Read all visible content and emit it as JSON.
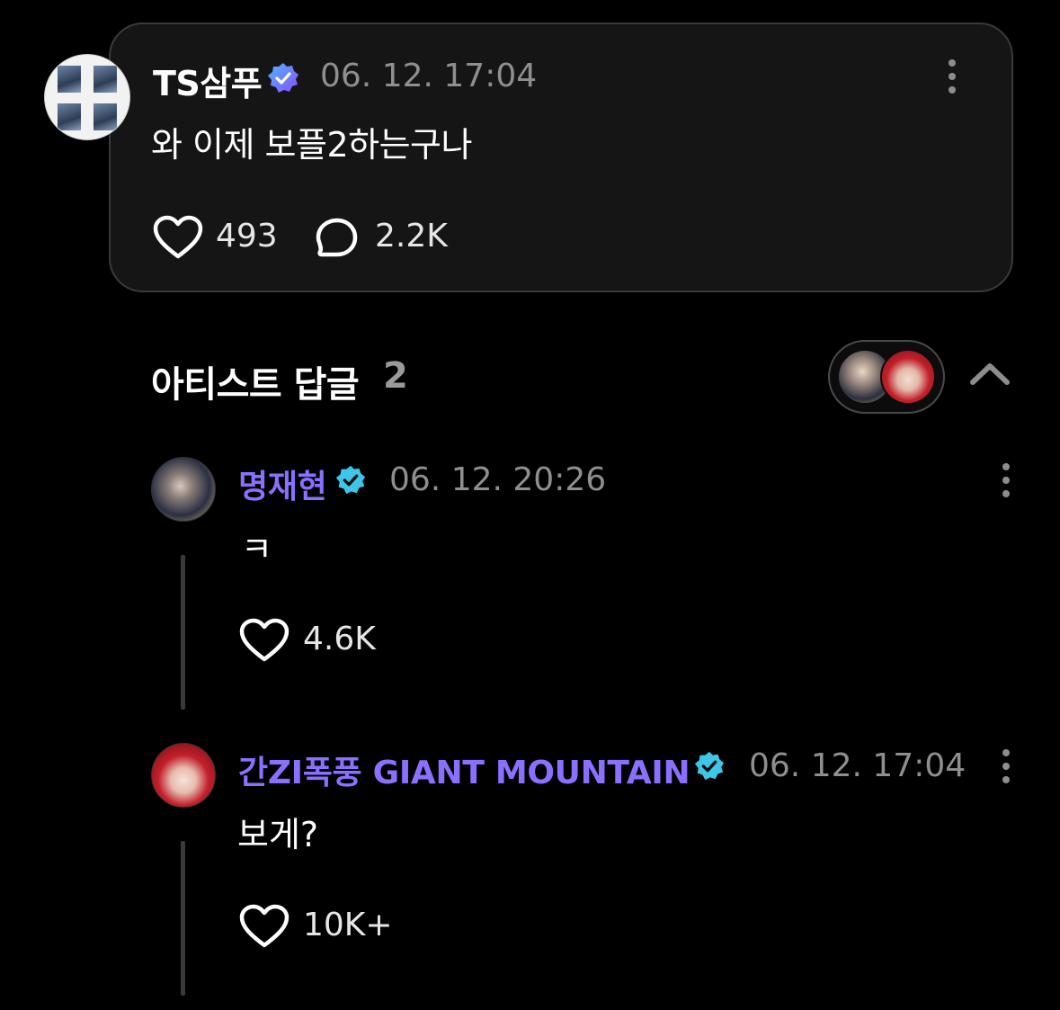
{
  "post": {
    "author": "TS삼푸",
    "time": "06. 12. 17:04",
    "body": "와 이제 보플2하는구나",
    "likes": "493",
    "comments": "2.2K"
  },
  "artist_replies": {
    "title": "아티스트 답글",
    "count": "2"
  },
  "replies": [
    {
      "name": "명재현",
      "time": "06. 12. 20:26",
      "text": "ㅋ",
      "likes": "4.6K"
    },
    {
      "name": "간ZI폭풍 GIANT MOUNTAIN",
      "time": "06. 12. 17:04",
      "text": "보게?",
      "likes": "10K+"
    }
  ],
  "colors": {
    "background": "#000000",
    "card": "#151515",
    "artist_name": "#8b70ff",
    "verified_badge_artist": "#3ec6e8",
    "verified_badge_user": "#7b5cff"
  },
  "icons": [
    "verified-badge-icon",
    "more-options-icon",
    "heart-icon",
    "comment-bubble-icon",
    "chevron-up-icon"
  ]
}
